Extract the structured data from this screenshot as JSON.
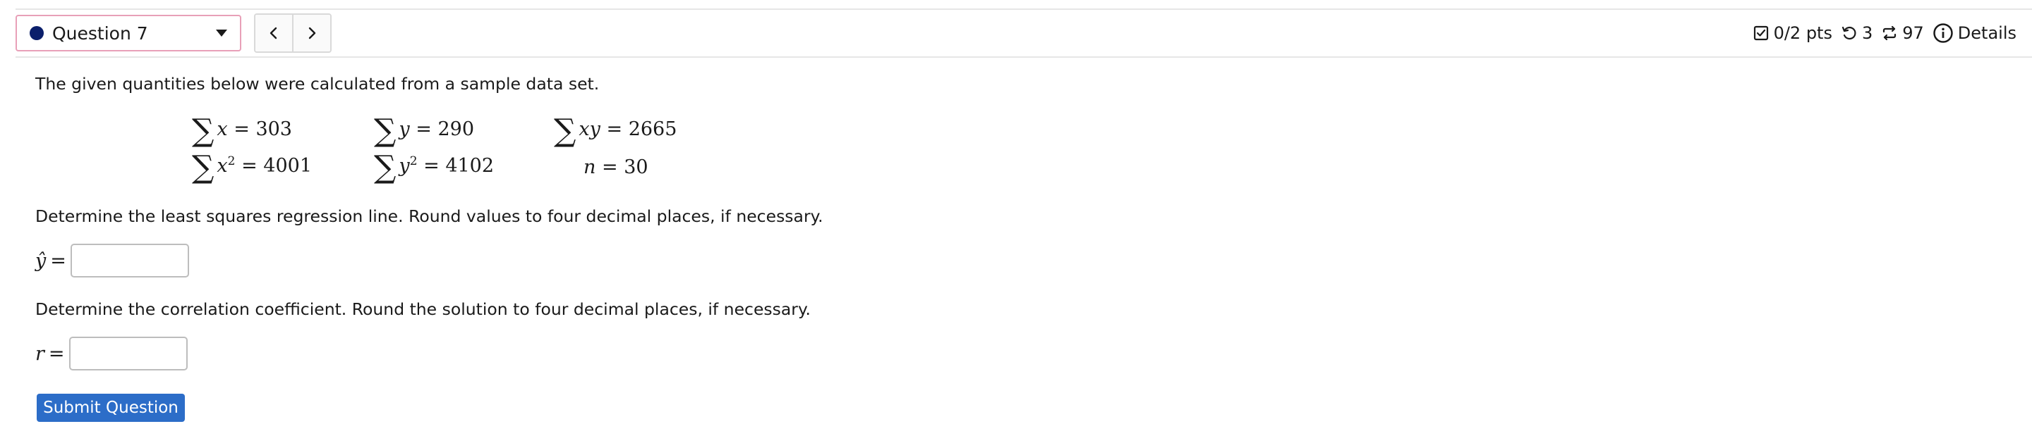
{
  "header": {
    "question_label": "Question 7",
    "points": "0/2 pts",
    "attempts": "3",
    "versions": "97",
    "details": "Details",
    "dot_color": "#0b1f6b"
  },
  "problem": {
    "intro": "The given quantities below were calculated from a sample data set.",
    "sums": {
      "sum_x_lhs": "x",
      "sum_x_rhs": "= 303",
      "sum_y_lhs": "y",
      "sum_y_rhs": "= 290",
      "sum_xy_lhs": "xy",
      "sum_xy_rhs": "= 2665",
      "sum_x2_lhs": "x",
      "sum_x2_rhs": "= 4001",
      "sum_y2_lhs": "y",
      "sum_y2_rhs": "= 4102",
      "n_lhs": "n",
      "n_rhs": "= 30"
    },
    "part1_prompt": "Determine the least squares regression line. Round values to four decimal places, if necessary.",
    "part1_label": "ŷ",
    "part2_prompt": "Determine the correlation coefficient. Round the solution to four decimal places, if necessary.",
    "part2_label": "r",
    "equals": "=",
    "part1_value": "",
    "part2_value": ""
  },
  "actions": {
    "submit_label": "Submit Question"
  },
  "icons": {
    "prev": "chevron-left-icon",
    "next": "chevron-right-icon",
    "points": "checkbox-icon",
    "attempts": "retry-icon",
    "versions": "repeat-icon",
    "details": "info-icon"
  }
}
